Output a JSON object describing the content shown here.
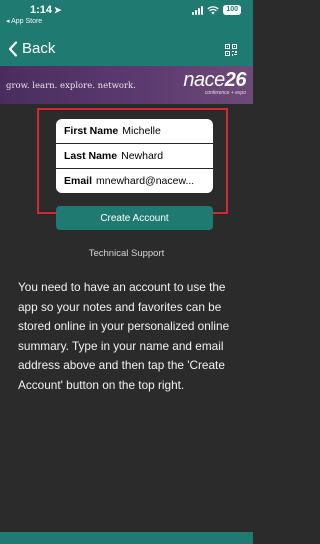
{
  "status_bar": {
    "time": "1:14",
    "back_app": "◂ App Store",
    "battery": "100"
  },
  "nav": {
    "back_label": "Back"
  },
  "banner": {
    "tagline": "grow. learn. explore. network.",
    "logo_main": "nace",
    "logo_number": "26",
    "logo_sub": "conference + expo"
  },
  "form": {
    "first_name_label": "First Name",
    "first_name_value": "Michelle",
    "last_name_label": "Last Name",
    "last_name_value": "Newhard",
    "email_label": "Email",
    "email_value": "mnewhard@nacew...",
    "create_button": "Create Account"
  },
  "support": {
    "label": "Technical Support"
  },
  "instructions": "You need to have an account to use the app so your notes and favorites can be stored online in your personalized online summary. Type in your name and email address above and then tap the 'Create Account' button on the top right.",
  "colors": {
    "accent": "#1f7a72",
    "background": "#2b2b2b",
    "highlight_border": "#d12a35",
    "banner": "#5b3a70"
  },
  "icons": [
    "location-arrow-icon",
    "signal-icon",
    "wifi-icon",
    "battery-icon",
    "chevron-left-icon",
    "qr-code-icon"
  ]
}
